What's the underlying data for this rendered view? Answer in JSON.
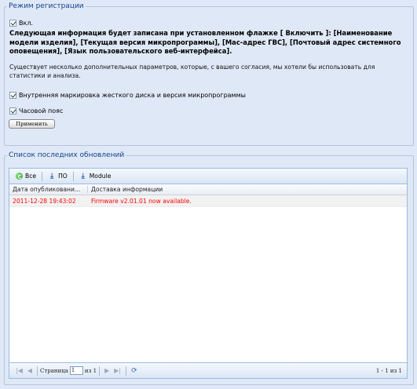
{
  "registration": {
    "legend": "Режим регистрации",
    "enable_label": "Вкл.",
    "info_bold": "Следующая информация будет записана при установленном флажке [ Включить ]: [Наименование модели изделия], [Текущая версия микропрограммы], [Мас-адрес ГВС], [Почтовый адрес системного оповещения], [Язык пользовательского веб-интерфейса].",
    "info_plain": "Существует несколько дополнительных параметров, которые, с вашего согласия, мы хотели бы использовать для статистики и анализа.",
    "option_hdd_label": "Внутренняя маркировка жесткого диска и версия микропрограммы",
    "option_timezone_label": "Часовой пояс",
    "apply_label": "Применить",
    "enable_checked": true,
    "option_hdd_checked": true,
    "option_timezone_checked": true
  },
  "updates": {
    "legend": "Список последних обновлений",
    "toolbar": {
      "all_label": "Все",
      "fw_label": "ПО",
      "module_label": "Module"
    },
    "columns": [
      "Дата опубликовани...",
      "Доставка информации"
    ],
    "rows": [
      {
        "date": "2011-12-28 19:43:02",
        "info": "Firmware v2.01.01 now available."
      }
    ],
    "pager": {
      "page_label": "Страница",
      "page_value": "1",
      "of_label": "из 1",
      "display_info": "1 - 1 из 1"
    }
  },
  "colors": {
    "background": "#dfe8f6",
    "legend_text": "#15428b",
    "row_text": "#ff0000",
    "panel_border": "#99bbe8"
  }
}
